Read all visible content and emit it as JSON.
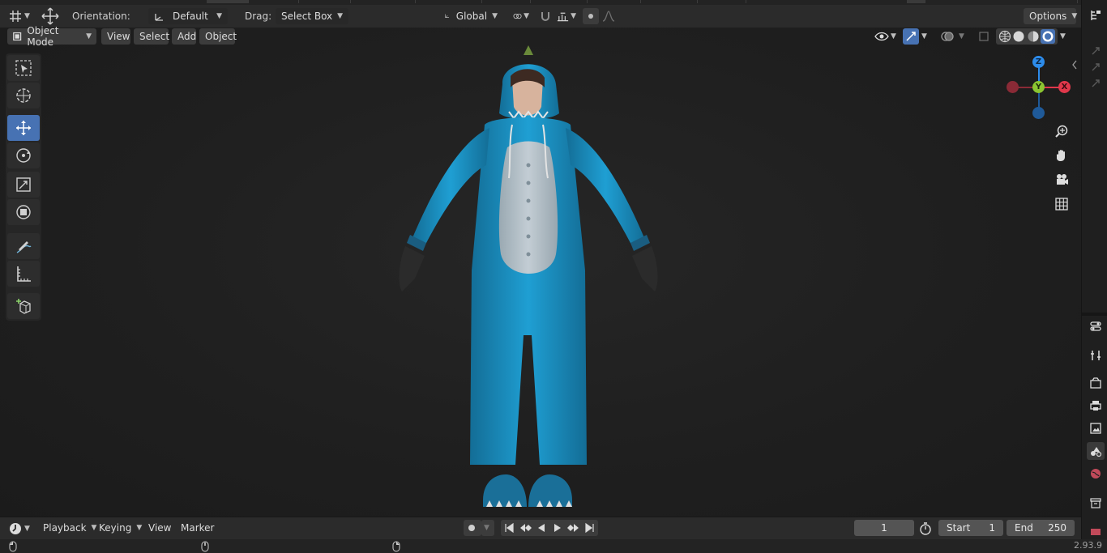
{
  "header": {
    "orientation_label": "Orientation:",
    "orientation_value": "Default",
    "drag_label": "Drag:",
    "drag_value": "Select Box",
    "transform_orientation": "Global",
    "options_label": "Options"
  },
  "viewport_header": {
    "mode": "Object Mode",
    "menus": [
      "View",
      "Select",
      "Add",
      "Object"
    ]
  },
  "gizmo": {
    "z": "Z",
    "y": "Y",
    "x": "X"
  },
  "timeline": {
    "menus": [
      "Playback",
      "Keying",
      "View",
      "Marker"
    ],
    "current_frame": "1",
    "start_label": "Start",
    "start_value": "1",
    "end_label": "End",
    "end_value": "250"
  },
  "status": {
    "version": "2.93.9"
  },
  "colors": {
    "accent": "#4772b3",
    "gizmo_x": "#e0384b",
    "gizmo_y": "#8bc531",
    "gizmo_z": "#2d8ceb",
    "onesie": "#1e9ed1"
  }
}
